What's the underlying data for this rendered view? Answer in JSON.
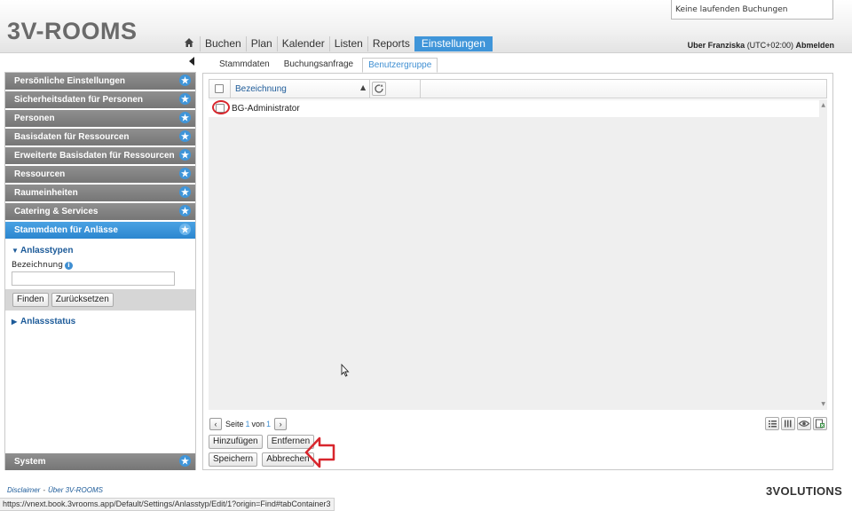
{
  "app": {
    "logo": "3V-ROOMS",
    "booking_status": "Keine laufenden Buchungen"
  },
  "nav": {
    "items": [
      "Buchen",
      "Plan",
      "Kalender",
      "Listen",
      "Reports",
      "Einstellungen"
    ],
    "active": "Einstellungen"
  },
  "user": {
    "prefix": "Uber Franziska",
    "timezone": "(UTC+02:00)",
    "logout": "Abmelden"
  },
  "sidebar": {
    "items": [
      "Persönliche Einstellungen",
      "Sicherheitsdaten für Personen",
      "Personen",
      "Basisdaten für Ressourcen",
      "Erweiterte Basisdaten für Ressourcen",
      "Ressourcen",
      "Raumeinheiten",
      "Catering & Services",
      "Stammdaten für Anlässe"
    ],
    "active_item": "Stammdaten für Anlässe",
    "subsection_open": "Anlasstypen",
    "field_label": "Bezeichnung",
    "field_value": "",
    "find_button": "Finden",
    "reset_button": "Zurücksetzen",
    "subsection_closed": "Anlassstatus",
    "system": "System"
  },
  "tabs": {
    "items": [
      "Stammdaten",
      "Buchungsanfrage",
      "Benutzergruppe"
    ],
    "active": "Benutzergruppe"
  },
  "grid": {
    "column": "Bezeichnung",
    "rows": [
      "BG-Administrator"
    ]
  },
  "pager": {
    "prefix": "Seite",
    "current": "1",
    "of": "von",
    "total": "1"
  },
  "buttons": {
    "add": "Hinzufügen",
    "remove": "Entfernen",
    "save": "Speichern",
    "cancel": "Abbrechen"
  },
  "footer": {
    "disclaimer": "Disclaimer",
    "about": "Über 3V-ROOMS",
    "status_url": "https://vnext.book.3vrooms.app/Default/Settings/Anlasstyp/Edit/1?origin=Find#tabContainer3",
    "brand": "3VOLUTIONS"
  },
  "colors": {
    "accent": "#3f95d9",
    "sidebar_gray": "#808080",
    "annotation_red": "#d8262d"
  }
}
